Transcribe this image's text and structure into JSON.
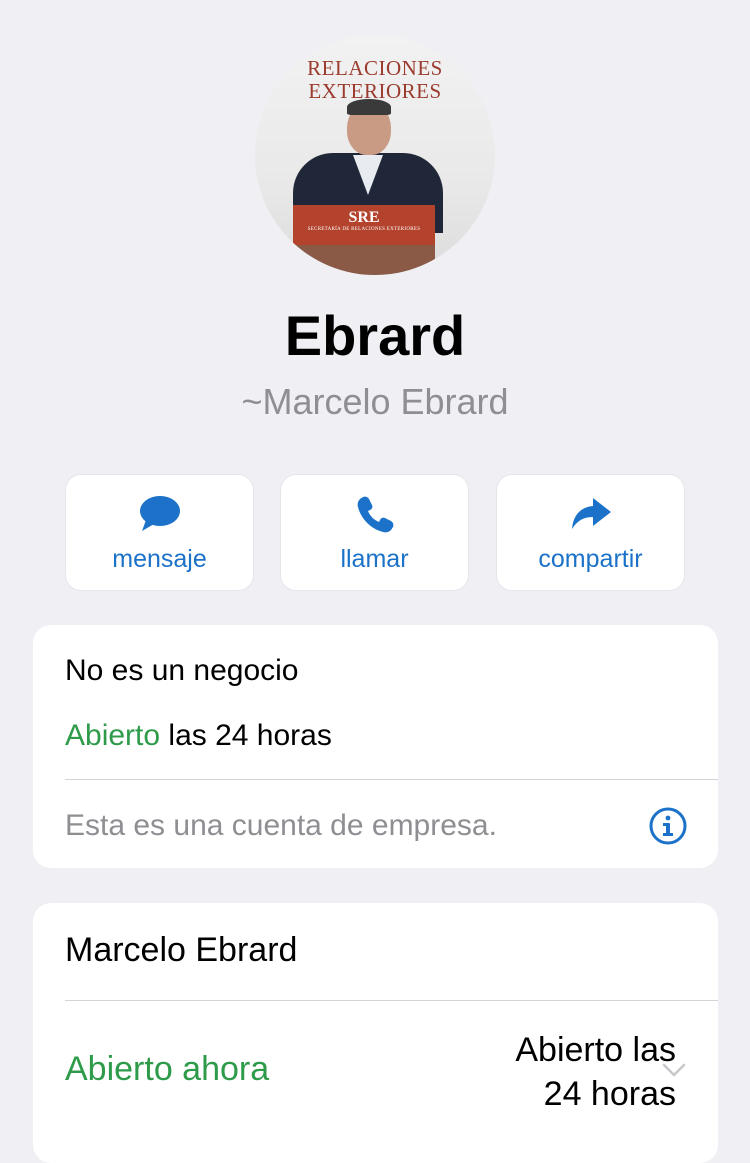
{
  "profile": {
    "avatar_banner_line1": "RELACIONES",
    "avatar_banner_line2": "EXTERIORES",
    "avatar_podium_text": "SRE",
    "avatar_podium_subtext": "SECRETARÍA DE RELACIONES EXTERIORES",
    "name": "Ebrard",
    "subtitle": "~Marcelo Ebrard"
  },
  "actions": [
    {
      "label": "mensaje",
      "icon": "speech-bubble-icon"
    },
    {
      "label": "llamar",
      "icon": "phone-icon"
    },
    {
      "label": "compartir",
      "icon": "share-arrow-icon"
    }
  ],
  "business_card": {
    "title": "No es un negocio",
    "status_open": "Abierto",
    "status_hours": "las 24 horas",
    "notice": "Esta es una cuenta de empresa.",
    "info_icon": "info-circle-icon"
  },
  "hours_card": {
    "name": "Marcelo Ebrard",
    "open_now": "Abierto ahora",
    "hours_line1": "Abierto las",
    "hours_line2": "24 horas",
    "chevron_icon": "chevron-down-icon"
  },
  "colors": {
    "background": "#efeff4",
    "accent_blue": "#1b72c8",
    "open_green": "#2e9b4b",
    "muted_gray": "#8e8e93"
  }
}
